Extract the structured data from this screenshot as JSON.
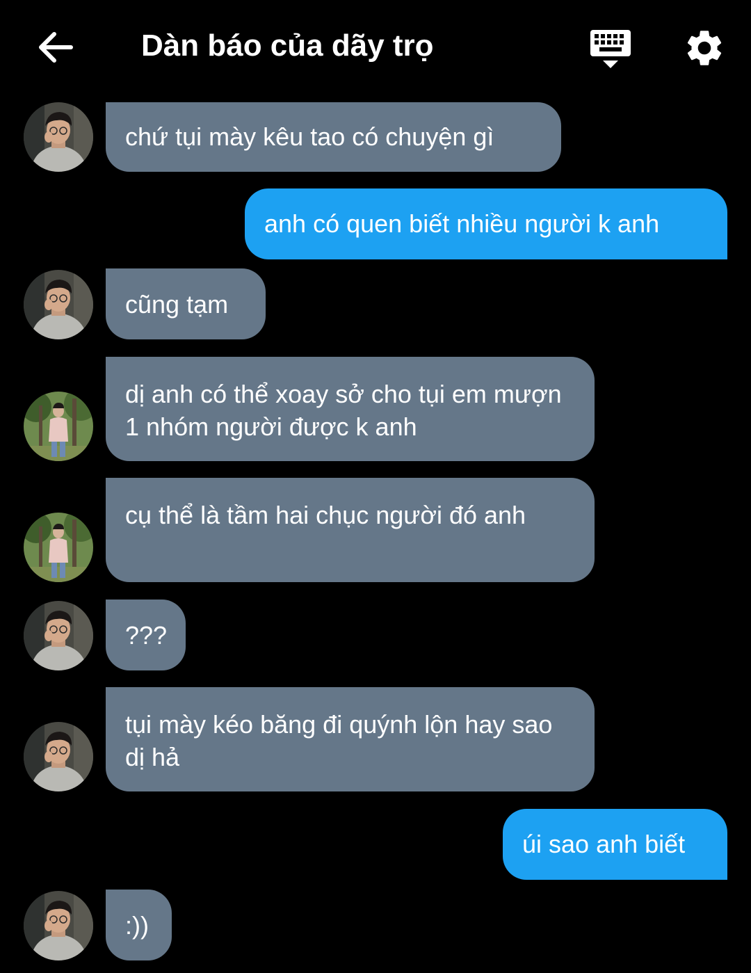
{
  "header": {
    "title": "Dàn báo của dãy trọ",
    "back_icon": "arrow-left-icon",
    "keyboard_icon": "keyboard-icon",
    "settings_icon": "gear-icon"
  },
  "colors": {
    "incoming_bubble": "#657789",
    "outgoing_bubble": "#1da1f2",
    "background": "#000000"
  },
  "messages": [
    {
      "direction": "incoming",
      "sender_avatar": "avatar-man-glasses",
      "text": "chứ tụi mày kêu tao có chuyện gì"
    },
    {
      "direction": "outgoing",
      "text": "anh có quen biết nhiều người k anh"
    },
    {
      "direction": "incoming",
      "sender_avatar": "avatar-man-glasses",
      "text": "cũng tạm"
    },
    {
      "direction": "incoming",
      "sender_avatar": "avatar-boy-park",
      "text": "dị anh có thể xoay sở cho tụi em mượn 1 nhóm người được k anh"
    },
    {
      "direction": "incoming",
      "sender_avatar": "avatar-boy-park",
      "text": "cụ thể là tầm hai chục người đó anh"
    },
    {
      "direction": "incoming",
      "sender_avatar": "avatar-man-glasses",
      "text": "???"
    },
    {
      "direction": "incoming",
      "sender_avatar": "avatar-man-glasses",
      "text": "tụi mày kéo băng đi quýnh lộn hay sao dị hả"
    },
    {
      "direction": "outgoing",
      "text": "úi sao anh biết"
    },
    {
      "direction": "incoming",
      "sender_avatar": "avatar-man-glasses",
      "text": ":))"
    }
  ]
}
